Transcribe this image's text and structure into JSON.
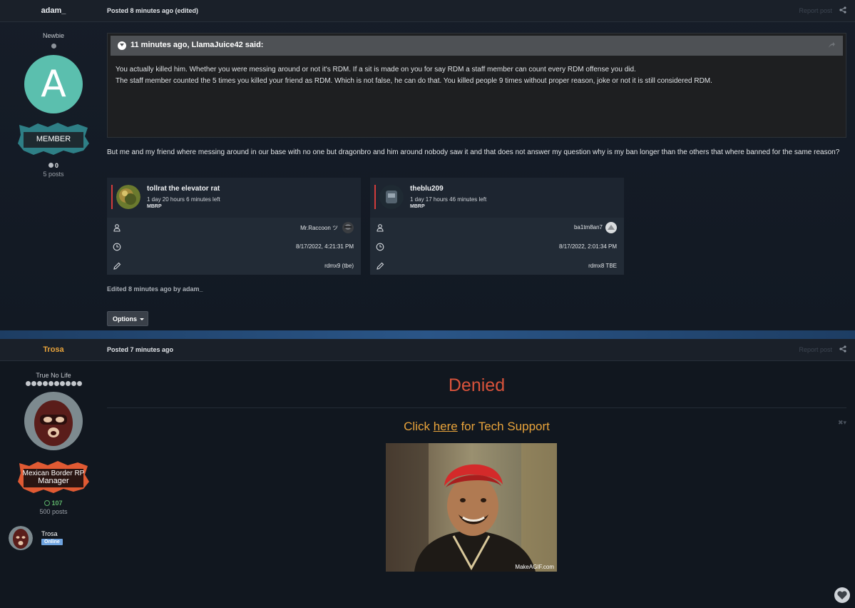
{
  "post1": {
    "author": "adam_",
    "posted": "Posted 8 minutes ago (edited)",
    "report": "Report post",
    "rank": "Newbie",
    "avatar_letter": "A",
    "badge": "MEMBER",
    "reputation": "0",
    "posts": "5 posts",
    "quote_header": "11 minutes ago, LlamaJuice42 said:",
    "quote_line1": "You actually killed him. Whether you were messing around or not it's RDM. If a sit is made on you for say RDM a staff member can count every RDM offense you did.",
    "quote_line2": "The staff member counted the 5 times you killed your friend as RDM. Which is not false, he can do that. You killed people 9 times without proper reason, joke or not it is still considered RDM.",
    "body": "But me and my friend where messing around in our base with no one but dragonbro and him around nobody saw it and that does not answer my question why is my ban longer than the others that where banned for the same reason?",
    "cards": [
      {
        "name": "tollrat the elevator rat",
        "time_left": "1 day 20 hours 6 minutes left",
        "server": "MBRP",
        "admin": "Mr.Raccoon ツ",
        "date": "8/17/2022, 4:21:31 PM",
        "reason": "rdmx9 (tbe)"
      },
      {
        "name": "theblu209",
        "time_left": "1 day 17 hours 46 minutes left",
        "server": "MBRP",
        "admin": "ba1tm8an7",
        "date": "8/17/2022, 2:01:34 PM",
        "reason": "rdmx8 TBE"
      }
    ],
    "edited": "Edited 8 minutes ago by adam_",
    "options": "Options"
  },
  "post2": {
    "author": "Trosa",
    "posted": "Posted 7 minutes ago",
    "report": "Report post",
    "rank": "True No Life",
    "badge_line1": "Mexican Border RP",
    "badge_line2": "Manager",
    "reputation": "107",
    "posts": "500 posts",
    "denied": "Denied",
    "click_pre": "Click ",
    "click_link": "here",
    "click_post": " for Tech Support",
    "gif_watermark": "MakeAGIF.com",
    "mini_name": "Trosa",
    "status": "Online"
  },
  "colors": {
    "author2": "#e8a33b",
    "denied": "#d9533b",
    "member_avatar": "#5bbfae",
    "online": "#6fa4e0",
    "card_bar": "#d23c3c"
  }
}
